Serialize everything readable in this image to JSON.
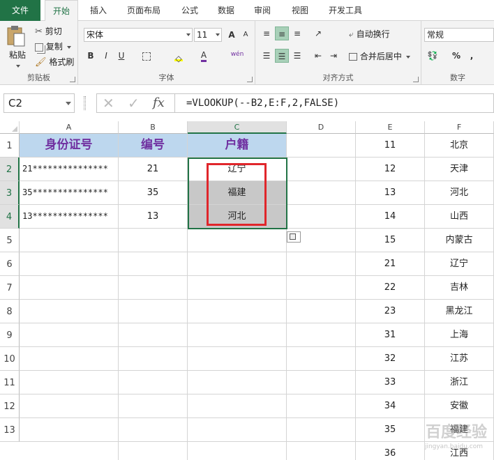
{
  "tabs": [
    {
      "label": "文件"
    },
    {
      "label": "开始"
    },
    {
      "label": "插入"
    },
    {
      "label": "页面布局"
    },
    {
      "label": "公式"
    },
    {
      "label": "数据"
    },
    {
      "label": "审阅"
    },
    {
      "label": "视图"
    },
    {
      "label": "开发工具"
    }
  ],
  "ribbon": {
    "clipboard": {
      "paste": "粘贴",
      "cut": "剪切",
      "copy": "复制",
      "format_painter": "格式刷",
      "label": "剪贴板"
    },
    "font": {
      "name": "宋体",
      "size": "11",
      "label": "字体",
      "bold": "B",
      "italic": "I",
      "underline": "U",
      "grow": "A",
      "shrink": "A",
      "phonetic": "wén"
    },
    "alignment": {
      "wrap": "自动换行",
      "merge": "合并后居中",
      "label": "对齐方式"
    },
    "number": {
      "format": "常规",
      "percent": "%",
      "comma": ",",
      "label": "数字"
    }
  },
  "formula_bar": {
    "namebox": "C2",
    "fx": "fx",
    "formula": "=VLOOKUP(--B2,E:F,2,FALSE)"
  },
  "columns": [
    "A",
    "B",
    "C",
    "D",
    "E",
    "F"
  ],
  "rows": [
    "1",
    "2",
    "3",
    "4",
    "5",
    "6",
    "7",
    "8",
    "9",
    "10",
    "11",
    "12",
    "13"
  ],
  "table": {
    "headers": [
      "身份证号",
      "编号",
      "户籍"
    ],
    "rows": [
      {
        "id": "21***************",
        "num": "21",
        "origin": "辽宁"
      },
      {
        "id": "35***************",
        "num": "35",
        "origin": "福建"
      },
      {
        "id": "13***************",
        "num": "13",
        "origin": "河北"
      }
    ]
  },
  "lookup": [
    {
      "code": "11",
      "name": "北京"
    },
    {
      "code": "12",
      "name": "天津"
    },
    {
      "code": "13",
      "name": "河北"
    },
    {
      "code": "14",
      "name": "山西"
    },
    {
      "code": "15",
      "name": "内蒙古"
    },
    {
      "code": "21",
      "name": "辽宁"
    },
    {
      "code": "22",
      "name": "吉林"
    },
    {
      "code": "23",
      "name": "黑龙江"
    },
    {
      "code": "31",
      "name": "上海"
    },
    {
      "code": "32",
      "name": "江苏"
    },
    {
      "code": "33",
      "name": "浙江"
    },
    {
      "code": "34",
      "name": "安徽"
    },
    {
      "code": "35",
      "name": "福建"
    },
    {
      "code": "36",
      "name": "江西"
    }
  ],
  "watermark": {
    "text": "百度经验",
    "url": "jingyan.baidu.com"
  },
  "colors": {
    "accent": "#217346",
    "header_fill": "#bdd7ee",
    "header_text": "#7030a0",
    "highlight": "#e0262b"
  }
}
